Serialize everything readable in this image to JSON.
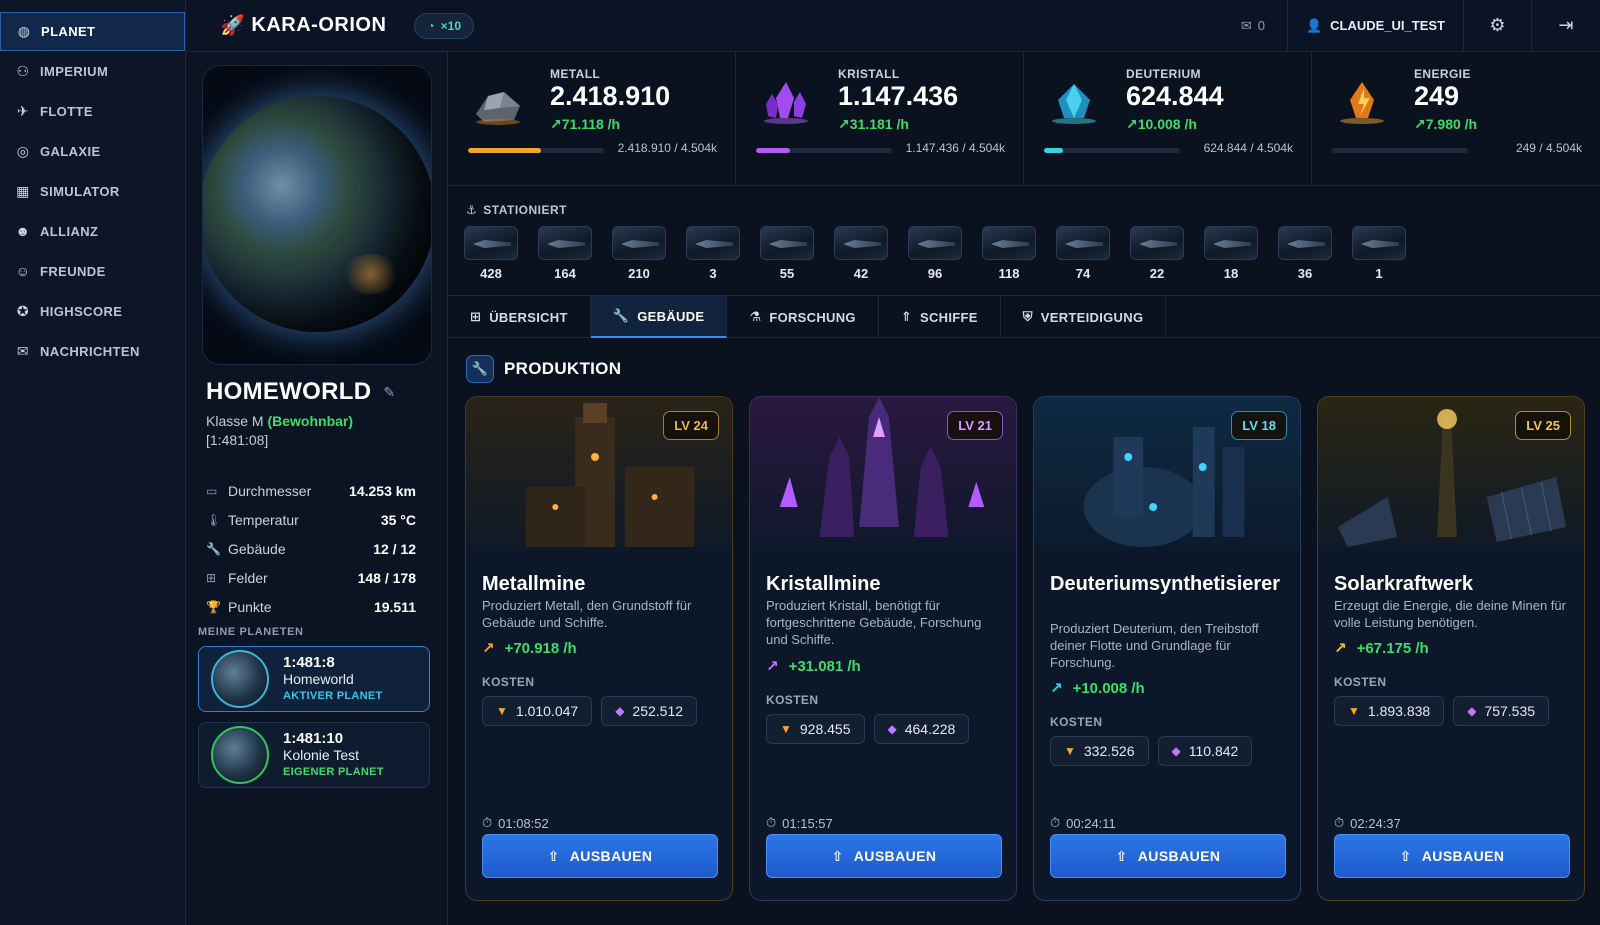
{
  "nav": {
    "items": [
      {
        "label": "PLANET",
        "icon": "globe-icon"
      },
      {
        "label": "IMPERIUM",
        "icon": "network-icon"
      },
      {
        "label": "FLOTTE",
        "icon": "fleet-icon"
      },
      {
        "label": "GALAXIE",
        "icon": "galaxy-icon"
      },
      {
        "label": "SIMULATOR",
        "icon": "calculator-icon"
      },
      {
        "label": "ALLIANZ",
        "icon": "people-icon"
      },
      {
        "label": "FREUNDE",
        "icon": "friends-icon"
      },
      {
        "label": "HIGHSCORE",
        "icon": "award-icon"
      },
      {
        "label": "NACHRICHTEN",
        "icon": "mail-icon"
      }
    ]
  },
  "header": {
    "title": "KARA-ORION",
    "speed": "×10",
    "mail_count": "0",
    "username": "CLAUDE_UI_TEST"
  },
  "planet": {
    "name": "HOMEWORLD",
    "class_prefix": "Klasse M",
    "habitable": "(Bewohnbar)",
    "coords": "[1:481:08]",
    "stats": [
      {
        "label": "Durchmesser",
        "value": "14.253 km"
      },
      {
        "label": "Temperatur",
        "value": "35 °C"
      },
      {
        "label": "Gebäude",
        "value": "12 / 12"
      },
      {
        "label": "Felder",
        "value": "148 / 178"
      },
      {
        "label": "Punkte",
        "value": "19.511"
      }
    ],
    "my_planets_title": "MEINE PLANETEN",
    "list": [
      {
        "coords": "1:481:8",
        "name": "Homeworld",
        "status": "AKTIVER PLANET"
      },
      {
        "coords": "1:481:10",
        "name": "Kolonie Test",
        "status": "EIGENER PLANET"
      }
    ]
  },
  "resources": [
    {
      "label": "METALL",
      "value": "2.418.910",
      "rate": "71.118 /h",
      "cap": "2.418.910 / 4.504k",
      "fill": 0.54,
      "color": "#f0a531"
    },
    {
      "label": "KRISTALL",
      "value": "1.147.436",
      "rate": "31.181 /h",
      "cap": "1.147.436 / 4.504k",
      "fill": 0.25,
      "color": "#b45cf0"
    },
    {
      "label": "DEUTERIUM",
      "value": "624.844",
      "rate": "10.008 /h",
      "cap": "624.844 / 4.504k",
      "fill": 0.14,
      "color": "#36d5e6"
    },
    {
      "label": "ENERGIE",
      "value": "249",
      "rate": "7.980 /h",
      "cap": "249 / 4.504k",
      "fill": 0.0,
      "color": "#f0c531"
    }
  ],
  "stationed": {
    "title": "STATIONIERT",
    "counts": [
      "428",
      "164",
      "210",
      "3",
      "55",
      "42",
      "96",
      "118",
      "74",
      "22",
      "18",
      "36",
      "1"
    ]
  },
  "tabs": [
    {
      "label": "ÜBERSICHT",
      "icon": "grid-icon"
    },
    {
      "label": "GEBÄUDE",
      "icon": "wrench-icon"
    },
    {
      "label": "FORSCHUNG",
      "icon": "flask-icon"
    },
    {
      "label": "SCHIFFE",
      "icon": "rocket-icon"
    },
    {
      "label": "VERTEIDIGUNG",
      "icon": "shield-icon"
    }
  ],
  "production": {
    "title": "PRODUKTION",
    "cost_label": "KOSTEN",
    "button_label": "AUSBAUEN",
    "cards": [
      {
        "level": "LV 24",
        "title": "Metallmine",
        "desc": "Produziert Metall, den Grundstoff für Gebäude und Schiffe.",
        "rate": "+70.918 /h",
        "cost_metal": "1.010.047",
        "cost_crystal": "252.512",
        "time": "01:08:52"
      },
      {
        "level": "LV 21",
        "title": "Kristallmine",
        "desc": "Produziert Kristall, benötigt für fortgeschrittene Gebäude, Forschung und Schiffe.",
        "rate": "+31.081 /h",
        "cost_metal": "928.455",
        "cost_crystal": "464.228",
        "time": "01:15:57"
      },
      {
        "level": "LV 18",
        "title": "Deuteriumsynthetisierer",
        "desc": "Produziert Deuterium, den Treibstoff deiner Flotte und Grundlage für Forschung.",
        "rate": "+10.008 /h",
        "cost_metal": "332.526",
        "cost_crystal": "110.842",
        "time": "00:24:11"
      },
      {
        "level": "LV 25",
        "title": "Solarkraftwerk",
        "desc": "Erzeugt die Energie, die deine Minen für volle Leistung benötigen.",
        "rate": "+67.175 /h",
        "cost_metal": "1.893.838",
        "cost_crystal": "757.535",
        "time": "02:24:37"
      }
    ]
  }
}
